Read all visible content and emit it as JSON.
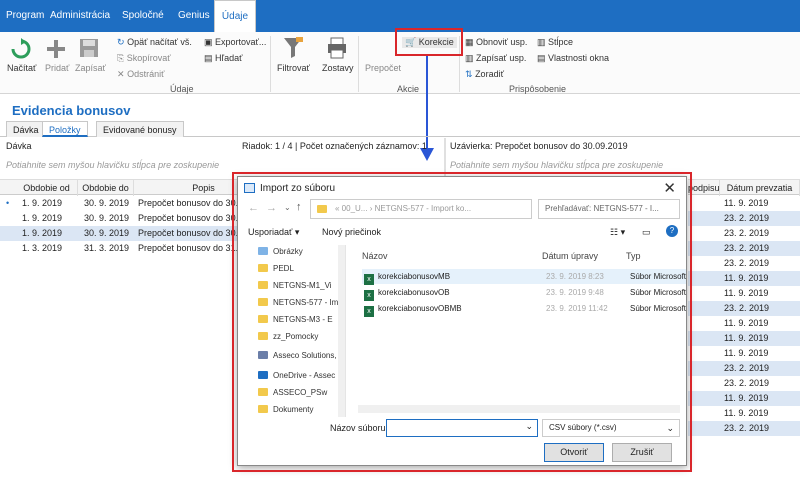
{
  "menu_tabs": [
    "Program",
    "Administrácia",
    "Spoločné",
    "Genius",
    "Údaje"
  ],
  "ribbon": {
    "nacitat": "Načítať",
    "pridat": "Pridať",
    "zapisat": "Zapísať",
    "opat_nacitat": "Opäť načítať vš.",
    "skopirovat": "Skopírovať",
    "odstranit": "Odstrániť",
    "exportovat": "Exportovať...",
    "hladat": "Hľadať",
    "filtrovat": "Filtrovať",
    "zostavy": "Zostavy",
    "prepocet": "Prepočet",
    "korekcie": "Korekcie",
    "obnovit_usp": "Obnoviť usp.",
    "zapisat_usp": "Zapísať usp.",
    "zoradit": "Zoradiť",
    "stlpce": "Stĺpce",
    "vlastnosti_okna": "Vlastnosti okna",
    "group_udaje": "Údaje",
    "group_akcie": "Akcie",
    "group_prisposobenie": "Prispôsobenie"
  },
  "page": {
    "title": "Evidencia bonusov",
    "tabs": [
      "Dávka",
      "Položky",
      "Evidované bonusy"
    ]
  },
  "left_panel": {
    "label": "Dávka",
    "row_info": "Riadok: 1 / 4 | Počet označených záznamov: 1",
    "groupby_hint": "Potiahnite sem myšou hlavičku stĺpca pre zoskupenie",
    "columns": [
      "Obdobie od",
      "Obdobie do",
      "Popis"
    ],
    "rows": [
      [
        "1. 9. 2019",
        "30. 9. 2019",
        "Prepočet bonusov do 30.09"
      ],
      [
        "1. 9. 2019",
        "30. 9. 2019",
        "Prepočet bonusov do 30.09"
      ],
      [
        "1. 9. 2019",
        "30. 9. 2019",
        "Prepočet bonusov do 30.09"
      ],
      [
        "1. 3. 2019",
        "31. 3. 2019",
        "Prepočet bonusov do 31.03"
      ]
    ]
  },
  "right_panel": {
    "label": "Uzávierka: Prepočet bonusov do 30.09.2019",
    "groupby_hint": "Potiahnite sem myšou hlavičku stĺpca pre zoskupenie",
    "columns": [
      "podpisu",
      "Dátum prevzatia"
    ],
    "dates": [
      "11. 9. 2019",
      "23. 2. 2019",
      "23. 2. 2019",
      "23. 2. 2019",
      "23. 2. 2019",
      "11. 9. 2019",
      "11. 9. 2019",
      "23. 2. 2019",
      "11. 9. 2019",
      "11. 9. 2019",
      "11. 9. 2019",
      "23. 2. 2019",
      "23. 2. 2019",
      "11. 9. 2019",
      "11. 9. 2019",
      "23. 2. 2019"
    ]
  },
  "dialog": {
    "title": "Import zo súboru",
    "address": "« 00_U... › NETGNS-577 - Import ko...",
    "search_placeholder": "Prehľadávať: NETGNS-577 - I...",
    "organize": "Usporiadať",
    "new_folder": "Nový priečinok",
    "nav_items": [
      "Obrázky",
      "PEDL",
      "NETGNS-M1_Vi",
      "NETGNS-577 - Im",
      "NETGNS-M3 - E",
      "zz_Pomocky",
      "Asseco Solutions,",
      "OneDrive - Assec",
      "ASSECO_PSw",
      "Dokumenty"
    ],
    "columns": [
      "Názov",
      "Dátum úpravy",
      "Typ"
    ],
    "files": [
      {
        "name": "korekciabonusovMB",
        "date": "23. 9. 2019 8:23",
        "type": "Súbor Microsoft"
      },
      {
        "name": "korekciabonusovOB",
        "date": "23. 9. 2019 9:48",
        "type": "Súbor Microsoft"
      },
      {
        "name": "korekciabonusovOBMB",
        "date": "23. 9. 2019 11:42",
        "type": "Súbor Microsoft"
      }
    ],
    "filename_label": "Názov súboru:",
    "filetype": "CSV súbory (*.csv)",
    "open_btn": "Otvoriť",
    "cancel_btn": "Zrušiť"
  },
  "colors": {
    "accent": "#1e6ec2",
    "highlight": "#d9262b"
  }
}
